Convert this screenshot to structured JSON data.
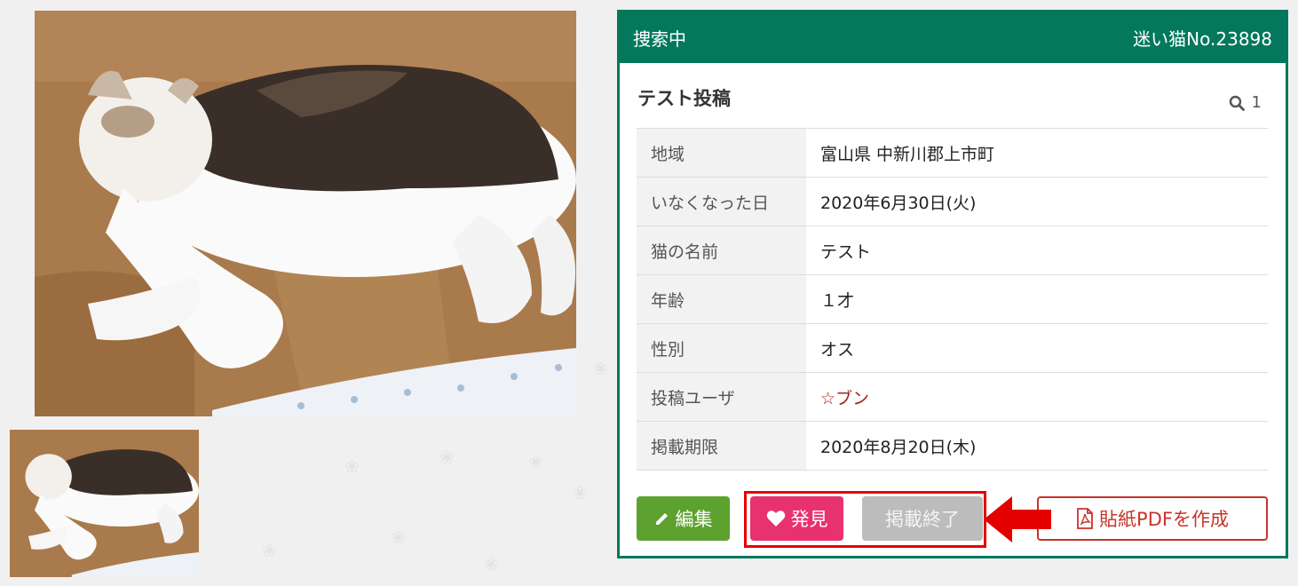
{
  "header": {
    "status": "捜索中",
    "case_number": "迷い猫No.23898"
  },
  "post": {
    "title": "テスト投稿",
    "views": "1"
  },
  "details": [
    {
      "key": "地域",
      "value": "富山県 中新川郡上市町"
    },
    {
      "key": "いなくなった日",
      "value": "2020年6月30日(火)"
    },
    {
      "key": "猫の名前",
      "value": "テスト"
    },
    {
      "key": "年齢",
      "value": "１才"
    },
    {
      "key": "性別",
      "value": "オス"
    },
    {
      "key": "投稿ユーザ",
      "value": "☆ブン"
    },
    {
      "key": "掲載期限",
      "value": "2020年8月20日(木)"
    }
  ],
  "buttons": {
    "edit": "編集",
    "found": "発見",
    "end": "掲載終了",
    "pdf": "貼紙PDFを作成"
  },
  "colors": {
    "brand_green": "#04785c",
    "edit": "#5da22e",
    "found": "#e8326f",
    "end": "#bcbcbc",
    "pdf": "#c8332b",
    "annotation": "#e50000"
  },
  "icons": {
    "edit": "pencil-icon",
    "found": "heart-icon",
    "pdf": "pdf-file-icon",
    "views": "search-icon"
  }
}
